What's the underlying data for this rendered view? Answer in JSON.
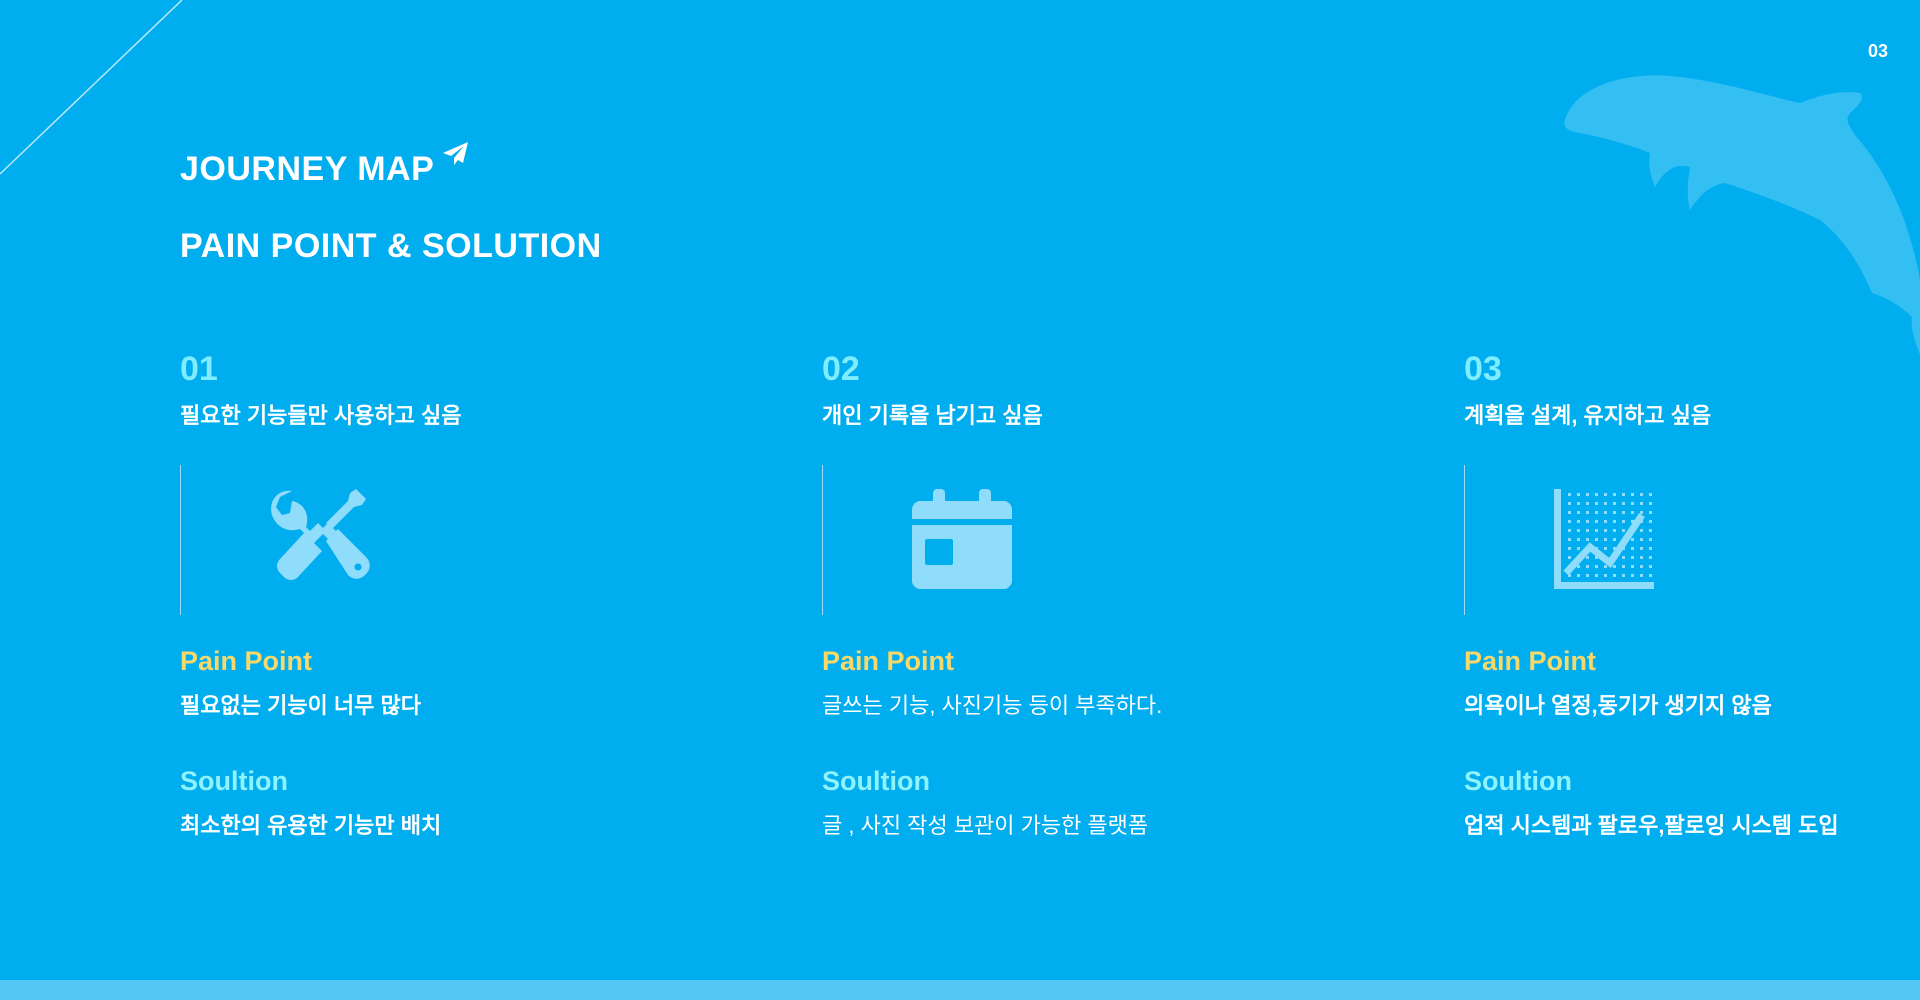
{
  "page_number": "03",
  "heading": "JOURNEY MAP",
  "subheading": "PAIN POINT & SOLUTION",
  "columns": [
    {
      "number": "01",
      "need": "필요한 기능들만 사용하고 싶음",
      "icon": "tools-icon",
      "pain_label": "Pain Point",
      "pain_text": "필요없는 기능이 너무 많다",
      "solution_label": "Soultion",
      "solution_text": "최소한의 유용한 기능만 배치"
    },
    {
      "number": "02",
      "need": "개인 기록을 남기고 싶음",
      "icon": "calendar-icon",
      "pain_label": "Pain Point",
      "pain_text": "글쓰는 기능, 사진기능 등이 부족하다.",
      "solution_label": "Soultion",
      "solution_text": "글 , 사진 작성 보관이 가능한 플랫폼"
    },
    {
      "number": "03",
      "need": "계획을 설계, 유지하고 싶음",
      "icon": "line-chart-icon",
      "pain_label": "Pain Point",
      "pain_text": "의욕이나 열정,동기가 생기지 않음",
      "solution_label": "Soultion",
      "solution_text": "업적 시스템과 팔로우,팔로잉 시스템 도입"
    }
  ],
  "colors": {
    "background": "#00adee",
    "number": "#7fecff",
    "pain_label": "#f7d96b",
    "solution_label": "#8ff3ff",
    "icon": "#8fdcfb",
    "footer_bar": "#54c8f4"
  }
}
